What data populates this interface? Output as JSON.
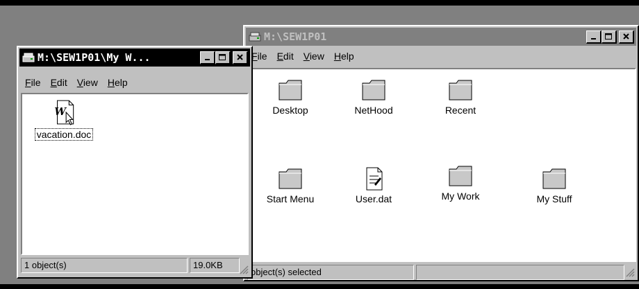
{
  "main_window": {
    "title": "M:\\SEW1P01",
    "menu": [
      {
        "label": "File",
        "u": "F"
      },
      {
        "label": "Edit",
        "u": "E"
      },
      {
        "label": "View",
        "u": "V"
      },
      {
        "label": "Help",
        "u": "H"
      }
    ],
    "items": [
      {
        "label": "Desktop",
        "icon": "folder-icon"
      },
      {
        "label": "NetHood",
        "icon": "folder-icon"
      },
      {
        "label": "Recent",
        "icon": "folder-icon"
      },
      {
        "label": "Start Menu",
        "icon": "folder-icon"
      },
      {
        "label": "User.dat",
        "icon": "document-icon"
      },
      {
        "label": "My Work",
        "icon": "folder-icon"
      },
      {
        "label": "My Stuff",
        "icon": "folder-icon"
      }
    ],
    "status": {
      "selected": "object(s) selected",
      "size": ""
    }
  },
  "sub_window": {
    "title": "M:\\SEW1P01\\My W...",
    "menu": [
      {
        "label": "File",
        "u": "F"
      },
      {
        "label": "Edit",
        "u": "E"
      },
      {
        "label": "View",
        "u": "V"
      },
      {
        "label": "Help",
        "u": "H"
      }
    ],
    "items": [
      {
        "label": "vacation.doc",
        "icon": "word-document-icon"
      }
    ],
    "status": {
      "count": "1 object(s)",
      "size": "19.0KB"
    }
  },
  "colors": {
    "desktop": "#808080",
    "window": "#c0c0c0",
    "active_title": "#000000",
    "inactive_title": "#808080"
  }
}
